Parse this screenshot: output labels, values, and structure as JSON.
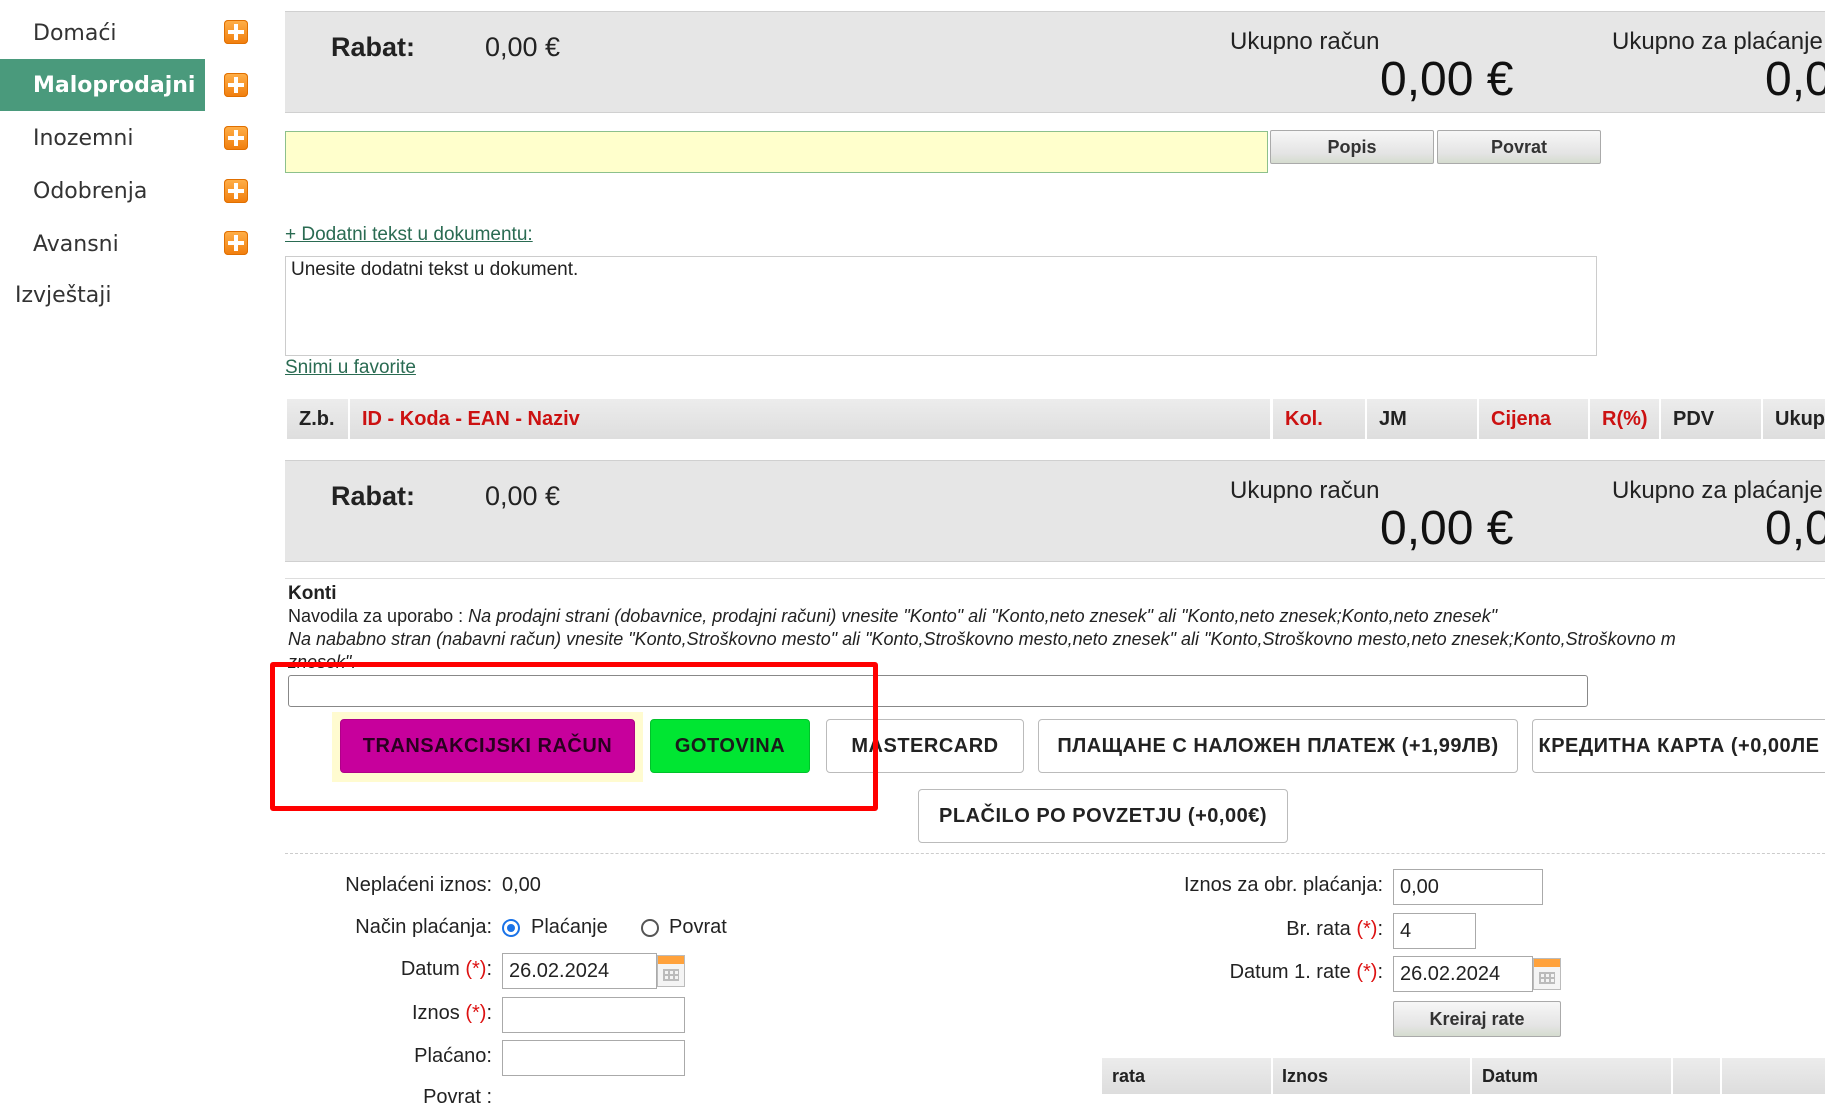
{
  "sidebar": {
    "items": [
      {
        "label": "Domaći"
      },
      {
        "label": "Maloprodajni"
      },
      {
        "label": "Inozemni"
      },
      {
        "label": "Odobrenja"
      },
      {
        "label": "Avansni"
      }
    ],
    "reports": "Izvještaji"
  },
  "totals": {
    "rabat_label": "Rabat:",
    "rabat_value": "0,00 €",
    "total_label": "Ukupno račun",
    "total_value": "0,00 €",
    "pay_label": "Ukupno za plaćanje",
    "pay_value": "0,0"
  },
  "search": {
    "value": "",
    "popis_label": "Popis",
    "povrat_label": "Povrat"
  },
  "extra_text": {
    "link": "+ Dodatni tekst u dokumentu:",
    "placeholder": "Unesite dodatni tekst u dokument.",
    "save_favorites": "Snimi u favorite"
  },
  "table": {
    "columns": [
      "Z.b.",
      "ID - Koda - EAN - Naziv",
      "Kol.",
      "JM",
      "Cijena",
      "R(%)",
      "PDV",
      "Ukup"
    ]
  },
  "konti": {
    "title": "Konti",
    "line1_prefix": "Navodila za uporabo : ",
    "line1_italic": "Na prodajni strani (dobavnice, prodajni računi) vnesite \"Konto\" ali \"Konto,neto znesek\" ali \"Konto,neto znesek;Konto,neto znesek\"",
    "line2_italic": "Na nababno stran (nabavni račun) vnesite \"Konto,Stroškovno mesto\" ali \"Konto,Stroškovno mesto,neto znesek\" ali \"Konto,Stroškovno mesto,neto znesek;Konto,Stroškovno m",
    "line3_italic": "znesek\".",
    "value": ""
  },
  "payment_methods": [
    {
      "label": "TRANSAKCIJSKI RAČUN"
    },
    {
      "label": "GOTOVINA"
    },
    {
      "label": "MASTERCARD"
    },
    {
      "label": "ПЛАЩАНЕ С НАЛОЖЕН ПЛАТЕЖ (+1,99ЛВ)"
    },
    {
      "label": "КРЕДИТНА КАРТА (+0,00ЛЕ"
    },
    {
      "label": "PLAČILO PO POVZETJU (+0,00€)"
    }
  ],
  "payment_form": {
    "unpaid_label": "Neplaćeni iznos:",
    "unpaid_value": "0,00",
    "method_label": "Način plaćanja:",
    "method_options": [
      "Plaćanje",
      "Povrat"
    ],
    "date_label": "Datum ",
    "date_value": "26.02.2024",
    "amount_label": "Iznos ",
    "amount_value": "",
    "paid_label": "Plaćano:",
    "paid_value": "",
    "refund_label": "Povrat :",
    "req_mark": "(*)",
    "colon": ":"
  },
  "installments": {
    "amount_label": "Iznos za obr. plaćanja:",
    "amount_value": "0,00",
    "count_label": "Br. rata ",
    "count_value": "4",
    "first_date_label": "Datum 1. rate ",
    "first_date_value": "26.02.2024",
    "create_button": "Kreiraj rate",
    "columns": [
      "rata",
      "Iznos",
      "Datum"
    ]
  },
  "colors": {
    "sidebar_active": "#4a9a7c",
    "transfer_button": "#c7009c",
    "cash_button": "#00e632",
    "highlight_box": "#ff0000",
    "required_mark": "#d11111"
  }
}
